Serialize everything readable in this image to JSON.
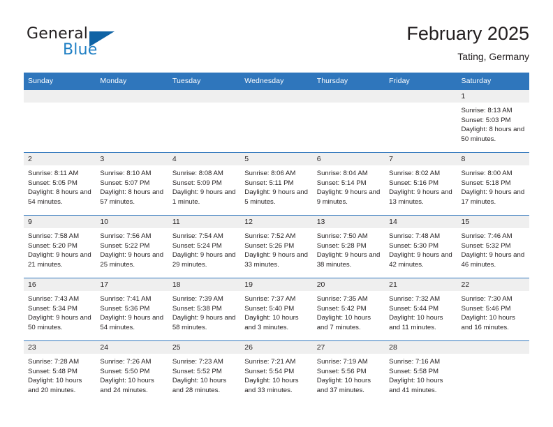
{
  "brand": {
    "name_part1": "General",
    "name_part2": "Blue",
    "mark": "triangle-logo"
  },
  "header": {
    "title": "February 2025",
    "location": "Tating, Germany"
  },
  "calendar": {
    "weekday_headers": [
      "Sunday",
      "Monday",
      "Tuesday",
      "Wednesday",
      "Thursday",
      "Friday",
      "Saturday"
    ],
    "accent_color": "#2f76bc",
    "datebar_color": "#efefef",
    "labels": {
      "sunrise": "Sunrise:",
      "sunset": "Sunset:",
      "daylight": "Daylight:"
    },
    "weeks": [
      [
        {
          "empty": true
        },
        {
          "empty": true
        },
        {
          "empty": true
        },
        {
          "empty": true
        },
        {
          "empty": true
        },
        {
          "empty": true
        },
        {
          "day": "1",
          "sunrise": "Sunrise: 8:13 AM",
          "sunset": "Sunset: 5:03 PM",
          "daylight": "Daylight: 8 hours and 50 minutes."
        }
      ],
      [
        {
          "day": "2",
          "sunrise": "Sunrise: 8:11 AM",
          "sunset": "Sunset: 5:05 PM",
          "daylight": "Daylight: 8 hours and 54 minutes."
        },
        {
          "day": "3",
          "sunrise": "Sunrise: 8:10 AM",
          "sunset": "Sunset: 5:07 PM",
          "daylight": "Daylight: 8 hours and 57 minutes."
        },
        {
          "day": "4",
          "sunrise": "Sunrise: 8:08 AM",
          "sunset": "Sunset: 5:09 PM",
          "daylight": "Daylight: 9 hours and 1 minute."
        },
        {
          "day": "5",
          "sunrise": "Sunrise: 8:06 AM",
          "sunset": "Sunset: 5:11 PM",
          "daylight": "Daylight: 9 hours and 5 minutes."
        },
        {
          "day": "6",
          "sunrise": "Sunrise: 8:04 AM",
          "sunset": "Sunset: 5:14 PM",
          "daylight": "Daylight: 9 hours and 9 minutes."
        },
        {
          "day": "7",
          "sunrise": "Sunrise: 8:02 AM",
          "sunset": "Sunset: 5:16 PM",
          "daylight": "Daylight: 9 hours and 13 minutes."
        },
        {
          "day": "8",
          "sunrise": "Sunrise: 8:00 AM",
          "sunset": "Sunset: 5:18 PM",
          "daylight": "Daylight: 9 hours and 17 minutes."
        }
      ],
      [
        {
          "day": "9",
          "sunrise": "Sunrise: 7:58 AM",
          "sunset": "Sunset: 5:20 PM",
          "daylight": "Daylight: 9 hours and 21 minutes."
        },
        {
          "day": "10",
          "sunrise": "Sunrise: 7:56 AM",
          "sunset": "Sunset: 5:22 PM",
          "daylight": "Daylight: 9 hours and 25 minutes."
        },
        {
          "day": "11",
          "sunrise": "Sunrise: 7:54 AM",
          "sunset": "Sunset: 5:24 PM",
          "daylight": "Daylight: 9 hours and 29 minutes."
        },
        {
          "day": "12",
          "sunrise": "Sunrise: 7:52 AM",
          "sunset": "Sunset: 5:26 PM",
          "daylight": "Daylight: 9 hours and 33 minutes."
        },
        {
          "day": "13",
          "sunrise": "Sunrise: 7:50 AM",
          "sunset": "Sunset: 5:28 PM",
          "daylight": "Daylight: 9 hours and 38 minutes."
        },
        {
          "day": "14",
          "sunrise": "Sunrise: 7:48 AM",
          "sunset": "Sunset: 5:30 PM",
          "daylight": "Daylight: 9 hours and 42 minutes."
        },
        {
          "day": "15",
          "sunrise": "Sunrise: 7:46 AM",
          "sunset": "Sunset: 5:32 PM",
          "daylight": "Daylight: 9 hours and 46 minutes."
        }
      ],
      [
        {
          "day": "16",
          "sunrise": "Sunrise: 7:43 AM",
          "sunset": "Sunset: 5:34 PM",
          "daylight": "Daylight: 9 hours and 50 minutes."
        },
        {
          "day": "17",
          "sunrise": "Sunrise: 7:41 AM",
          "sunset": "Sunset: 5:36 PM",
          "daylight": "Daylight: 9 hours and 54 minutes."
        },
        {
          "day": "18",
          "sunrise": "Sunrise: 7:39 AM",
          "sunset": "Sunset: 5:38 PM",
          "daylight": "Daylight: 9 hours and 58 minutes."
        },
        {
          "day": "19",
          "sunrise": "Sunrise: 7:37 AM",
          "sunset": "Sunset: 5:40 PM",
          "daylight": "Daylight: 10 hours and 3 minutes."
        },
        {
          "day": "20",
          "sunrise": "Sunrise: 7:35 AM",
          "sunset": "Sunset: 5:42 PM",
          "daylight": "Daylight: 10 hours and 7 minutes."
        },
        {
          "day": "21",
          "sunrise": "Sunrise: 7:32 AM",
          "sunset": "Sunset: 5:44 PM",
          "daylight": "Daylight: 10 hours and 11 minutes."
        },
        {
          "day": "22",
          "sunrise": "Sunrise: 7:30 AM",
          "sunset": "Sunset: 5:46 PM",
          "daylight": "Daylight: 10 hours and 16 minutes."
        }
      ],
      [
        {
          "day": "23",
          "sunrise": "Sunrise: 7:28 AM",
          "sunset": "Sunset: 5:48 PM",
          "daylight": "Daylight: 10 hours and 20 minutes."
        },
        {
          "day": "24",
          "sunrise": "Sunrise: 7:26 AM",
          "sunset": "Sunset: 5:50 PM",
          "daylight": "Daylight: 10 hours and 24 minutes."
        },
        {
          "day": "25",
          "sunrise": "Sunrise: 7:23 AM",
          "sunset": "Sunset: 5:52 PM",
          "daylight": "Daylight: 10 hours and 28 minutes."
        },
        {
          "day": "26",
          "sunrise": "Sunrise: 7:21 AM",
          "sunset": "Sunset: 5:54 PM",
          "daylight": "Daylight: 10 hours and 33 minutes."
        },
        {
          "day": "27",
          "sunrise": "Sunrise: 7:19 AM",
          "sunset": "Sunset: 5:56 PM",
          "daylight": "Daylight: 10 hours and 37 minutes."
        },
        {
          "day": "28",
          "sunrise": "Sunrise: 7:16 AM",
          "sunset": "Sunset: 5:58 PM",
          "daylight": "Daylight: 10 hours and 41 minutes."
        },
        {
          "empty": true
        }
      ]
    ]
  }
}
